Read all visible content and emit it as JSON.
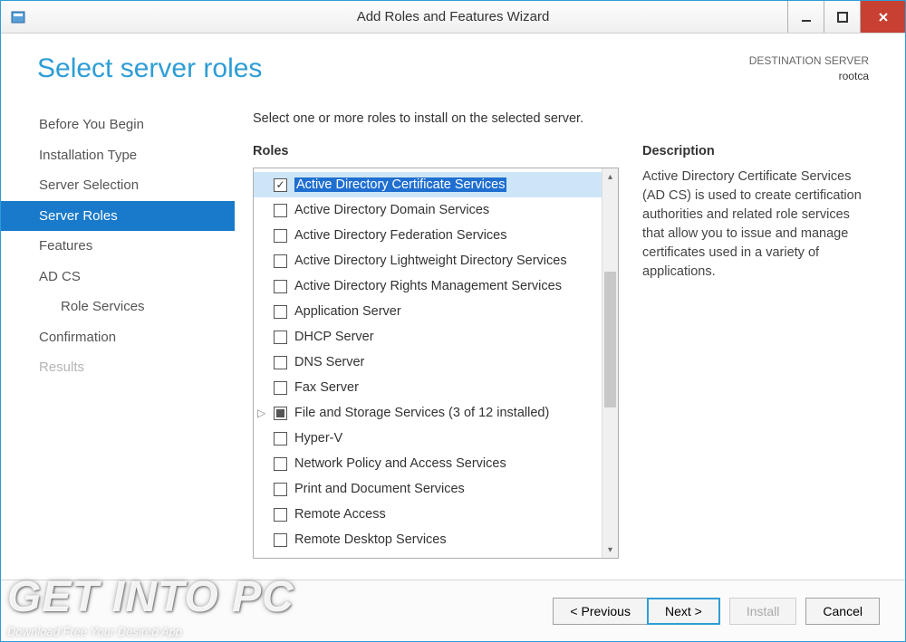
{
  "window": {
    "title": "Add Roles and Features Wizard"
  },
  "header": {
    "page_title": "Select server roles",
    "dest_label": "DESTINATION SERVER",
    "dest_value": "rootca"
  },
  "sidebar": {
    "items": [
      {
        "label": "Before You Begin",
        "selected": false
      },
      {
        "label": "Installation Type",
        "selected": false
      },
      {
        "label": "Server Selection",
        "selected": false
      },
      {
        "label": "Server Roles",
        "selected": true
      },
      {
        "label": "Features",
        "selected": false
      },
      {
        "label": "AD CS",
        "selected": false
      },
      {
        "label": "Role Services",
        "selected": false,
        "indent": true
      },
      {
        "label": "Confirmation",
        "selected": false
      },
      {
        "label": "Results",
        "selected": false,
        "disabled": true
      }
    ]
  },
  "main": {
    "instruction": "Select one or more roles to install on the selected server.",
    "roles_label": "Roles",
    "desc_label": "Description",
    "description": "Active Directory Certificate Services (AD CS) is used to create certification authorities and related role services that allow you to issue and manage certificates used in a variety of applications.",
    "roles": [
      {
        "label": "Active Directory Certificate Services",
        "checked": true,
        "selected": true
      },
      {
        "label": "Active Directory Domain Services"
      },
      {
        "label": "Active Directory Federation Services"
      },
      {
        "label": "Active Directory Lightweight Directory Services"
      },
      {
        "label": "Active Directory Rights Management Services"
      },
      {
        "label": "Application Server"
      },
      {
        "label": "DHCP Server"
      },
      {
        "label": "DNS Server"
      },
      {
        "label": "Fax Server"
      },
      {
        "label": "File and Storage Services (3 of 12 installed)",
        "partial": true,
        "expandable": true
      },
      {
        "label": "Hyper-V"
      },
      {
        "label": "Network Policy and Access Services"
      },
      {
        "label": "Print and Document Services"
      },
      {
        "label": "Remote Access"
      },
      {
        "label": "Remote Desktop Services"
      }
    ]
  },
  "footer": {
    "previous": "< Previous",
    "next": "Next >",
    "install": "Install",
    "cancel": "Cancel"
  },
  "watermark": {
    "main": "GET INTO PC",
    "sub": "Download Free Your Desired App"
  }
}
